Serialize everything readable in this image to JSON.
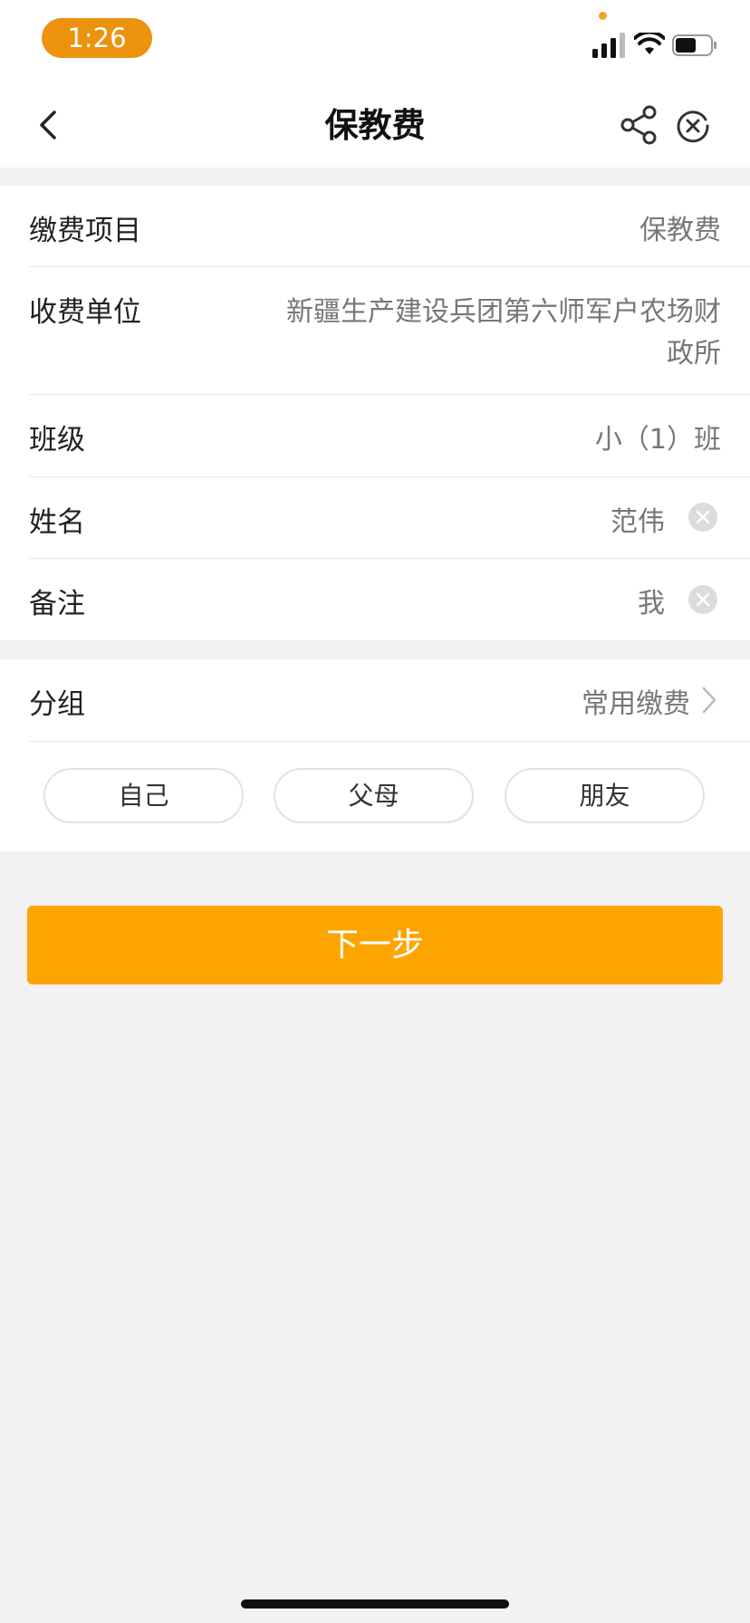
{
  "status_bar": {
    "time": "1:26",
    "icons": [
      "signal-icon",
      "wifi-icon",
      "battery-icon"
    ],
    "accent_color": "#ec920c"
  },
  "nav": {
    "title": "保教费",
    "icons": [
      "back-arrow-icon",
      "share-icon",
      "close-circle-icon"
    ]
  },
  "form": {
    "item": {
      "label": "缴费项目",
      "value": "保教费"
    },
    "payee": {
      "label": "收费单位",
      "value_line1": "新疆生产建设兵团第六师军户农场财",
      "value_line2": "政所"
    },
    "class": {
      "label": "班级",
      "value": "小（1）班"
    },
    "name": {
      "label": "姓名",
      "value": "范伟"
    },
    "note": {
      "label": "备注",
      "value": "我"
    }
  },
  "group": {
    "label": "分组",
    "value": "常用缴费",
    "chips": [
      "自己",
      "父母",
      "朋友"
    ]
  },
  "next_button": {
    "label": "下一步",
    "color": "#fca500"
  }
}
